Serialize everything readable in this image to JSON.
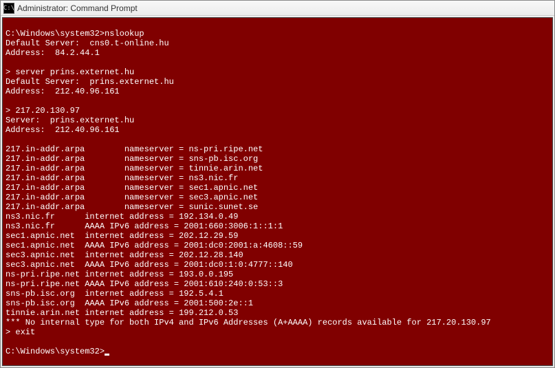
{
  "window": {
    "icon_text": "C:\\",
    "title": "Administrator: Command Prompt"
  },
  "terminal": {
    "lines": [
      "",
      "C:\\Windows\\system32>nslookup",
      "Default Server:  cns0.t-online.hu",
      "Address:  84.2.44.1",
      "",
      "> server prins.externet.hu",
      "Default Server:  prins.externet.hu",
      "Address:  212.40.96.161",
      "",
      "> 217.20.130.97",
      "Server:  prins.externet.hu",
      "Address:  212.40.96.161",
      "",
      "217.in-addr.arpa        nameserver = ns-pri.ripe.net",
      "217.in-addr.arpa        nameserver = sns-pb.isc.org",
      "217.in-addr.arpa        nameserver = tinnie.arin.net",
      "217.in-addr.arpa        nameserver = ns3.nic.fr",
      "217.in-addr.arpa        nameserver = sec1.apnic.net",
      "217.in-addr.arpa        nameserver = sec3.apnic.net",
      "217.in-addr.arpa        nameserver = sunic.sunet.se",
      "ns3.nic.fr      internet address = 192.134.0.49",
      "ns3.nic.fr      AAAA IPv6 address = 2001:660:3006:1::1:1",
      "sec1.apnic.net  internet address = 202.12.29.59",
      "sec1.apnic.net  AAAA IPv6 address = 2001:dc0:2001:a:4608::59",
      "sec3.apnic.net  internet address = 202.12.28.140",
      "sec3.apnic.net  AAAA IPv6 address = 2001:dc0:1:0:4777::140",
      "ns-pri.ripe.net internet address = 193.0.0.195",
      "ns-pri.ripe.net AAAA IPv6 address = 2001:610:240:0:53::3",
      "sns-pb.isc.org  internet address = 192.5.4.1",
      "sns-pb.isc.org  AAAA IPv6 address = 2001:500:2e::1",
      "tinnie.arin.net internet address = 199.212.0.53",
      "*** No internal type for both IPv4 and IPv6 Addresses (A+AAAA) records available for 217.20.130.97",
      "> exit",
      "",
      "C:\\Windows\\system32>"
    ]
  }
}
